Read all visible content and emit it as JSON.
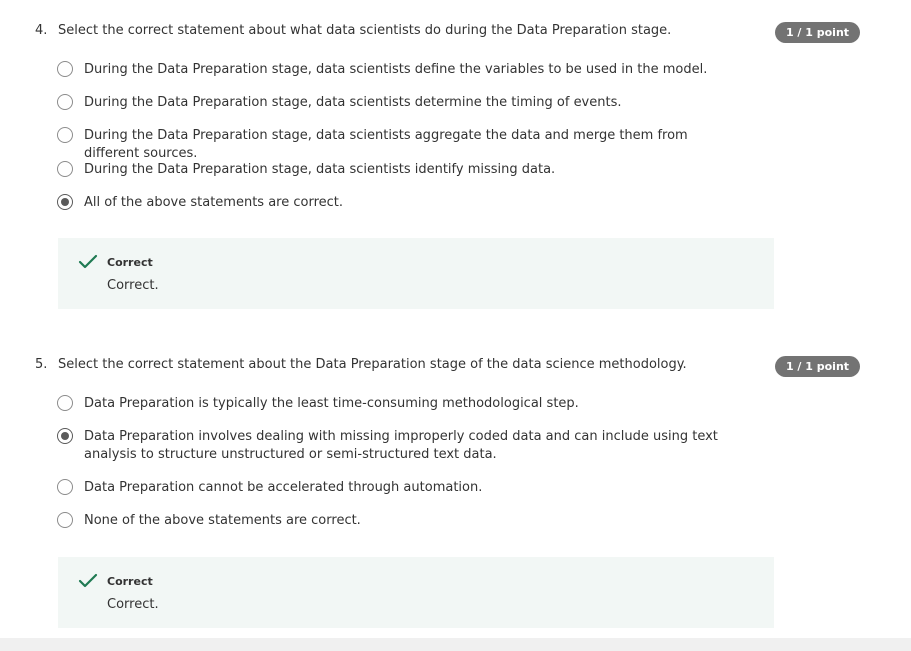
{
  "questions": [
    {
      "number": "4.",
      "text": "Select the correct statement about what data scientists do during the Data Preparation stage.",
      "points": "1 / 1 point",
      "options": [
        {
          "label": "During the Data Preparation stage, data scientists define the variables to be used in the model.",
          "selected": false
        },
        {
          "label": "During the Data Preparation stage, data scientists determine the timing of events.",
          "selected": false
        },
        {
          "label": "During the Data Preparation stage, data scientists aggregate the data and merge them from different sources.",
          "selected": false
        },
        {
          "label": "During the Data Preparation stage, data scientists identify missing data.",
          "selected": false
        },
        {
          "label": "All of the above statements are correct.",
          "selected": true
        }
      ],
      "feedback": {
        "icon": "checkmark-icon",
        "title": "Correct",
        "text": "Correct.",
        "color": "#1f7a53"
      }
    },
    {
      "number": "5.",
      "text": "Select the correct statement about the Data Preparation stage of the data science methodology.",
      "points": "1 / 1 point",
      "options": [
        {
          "label": "Data Preparation is typically the least time-consuming methodological step.",
          "selected": false
        },
        {
          "label": "Data Preparation involves dealing with missing improperly coded data and can include using text analysis to structure unstructured or semi-structured text data.",
          "selected": true
        },
        {
          "label": "Data Preparation cannot be accelerated through automation.",
          "selected": false
        },
        {
          "label": "None of the above statements are correct.",
          "selected": false
        }
      ],
      "feedback": {
        "icon": "checkmark-icon",
        "title": "Correct",
        "text": "Correct.",
        "color": "#1f7a53"
      }
    }
  ],
  "colors": {
    "points_badge": "#737373",
    "feedback_bg": "#f2f7f5",
    "check": "#1f7a53"
  }
}
